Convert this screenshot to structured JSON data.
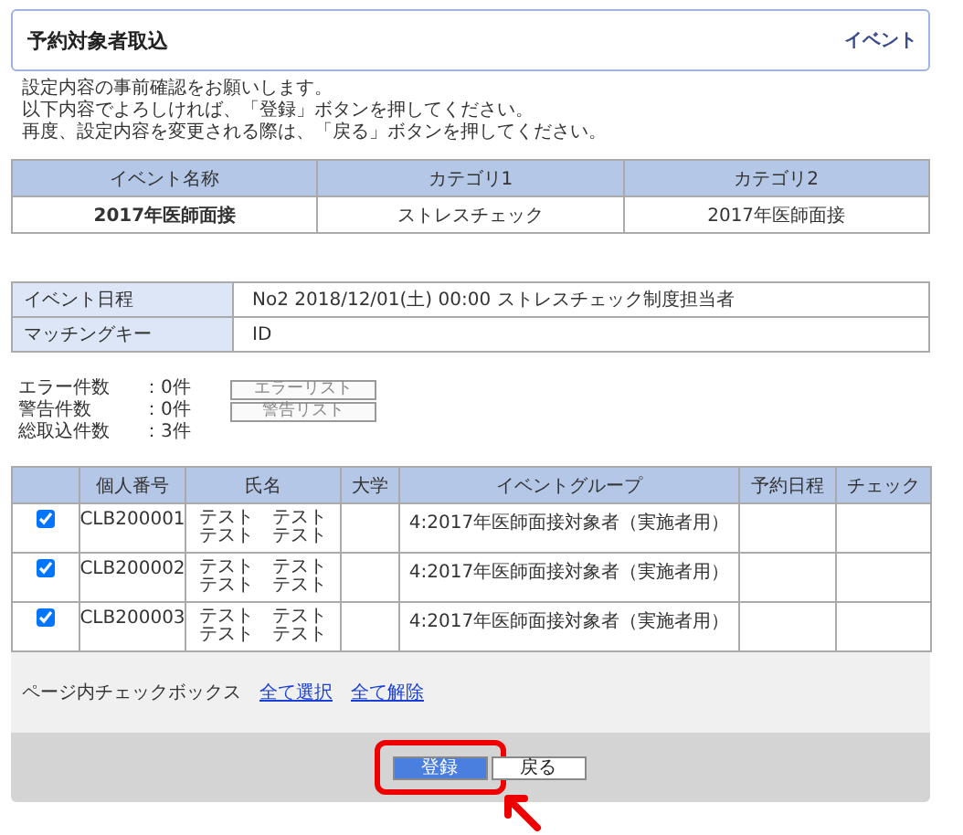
{
  "header": {
    "title": "予約対象者取込",
    "link": "イベント"
  },
  "instructions": [
    "設定内容の事前確認をお願いします。",
    "以下内容でよろしければ、「登録」ボタンを押してください。",
    "再度、設定内容を変更される際は、「戻る」ボタンを押してください。"
  ],
  "event_table": {
    "columns": [
      "イベント名称",
      "カテゴリ1",
      "カテゴリ2"
    ],
    "row": [
      "2017年医師面接",
      "ストレスチェック",
      "2017年医師面接"
    ]
  },
  "details": [
    {
      "label": "イベント日程",
      "value": "No2 2018/12/01(土) 00:00 ストレスチェック制度担当者"
    },
    {
      "label": "マッチングキー",
      "value": "ID"
    }
  ],
  "counts": [
    {
      "label": "エラー件数",
      "value": "：0件",
      "button": "エラーリスト"
    },
    {
      "label": "警告件数",
      "value": "：0件",
      "button": "警告リスト"
    },
    {
      "label": "総取込件数",
      "value": "：3件"
    }
  ],
  "table": {
    "columns": [
      "個人番号",
      "氏名",
      "大学",
      "イベントグループ",
      "予約日程",
      "チェック"
    ],
    "rows": [
      {
        "checked": true,
        "id": "CLB200001",
        "name": [
          "テスト　テスト",
          "テスト　テスト"
        ],
        "group": "4:2017年医師面接対象者（実施者用）"
      },
      {
        "checked": true,
        "id": "CLB200002",
        "name": [
          "テスト　テスト",
          "テスト　テスト"
        ],
        "group": "4:2017年医師面接対象者（実施者用）"
      },
      {
        "checked": true,
        "id": "CLB200003",
        "name": [
          "テスト　テスト",
          "テスト　テスト"
        ],
        "group": "4:2017年医師面接対象者（実施者用）"
      }
    ]
  },
  "page_checkbox": {
    "label": "ページ内チェックボックス",
    "links": [
      "全て選択",
      "全て解除"
    ]
  },
  "buttons": [
    {
      "label": "登録",
      "kind": "primary",
      "highlighted": true
    },
    {
      "label": "戻る",
      "kind": "secondary",
      "highlighted": false
    }
  ]
}
